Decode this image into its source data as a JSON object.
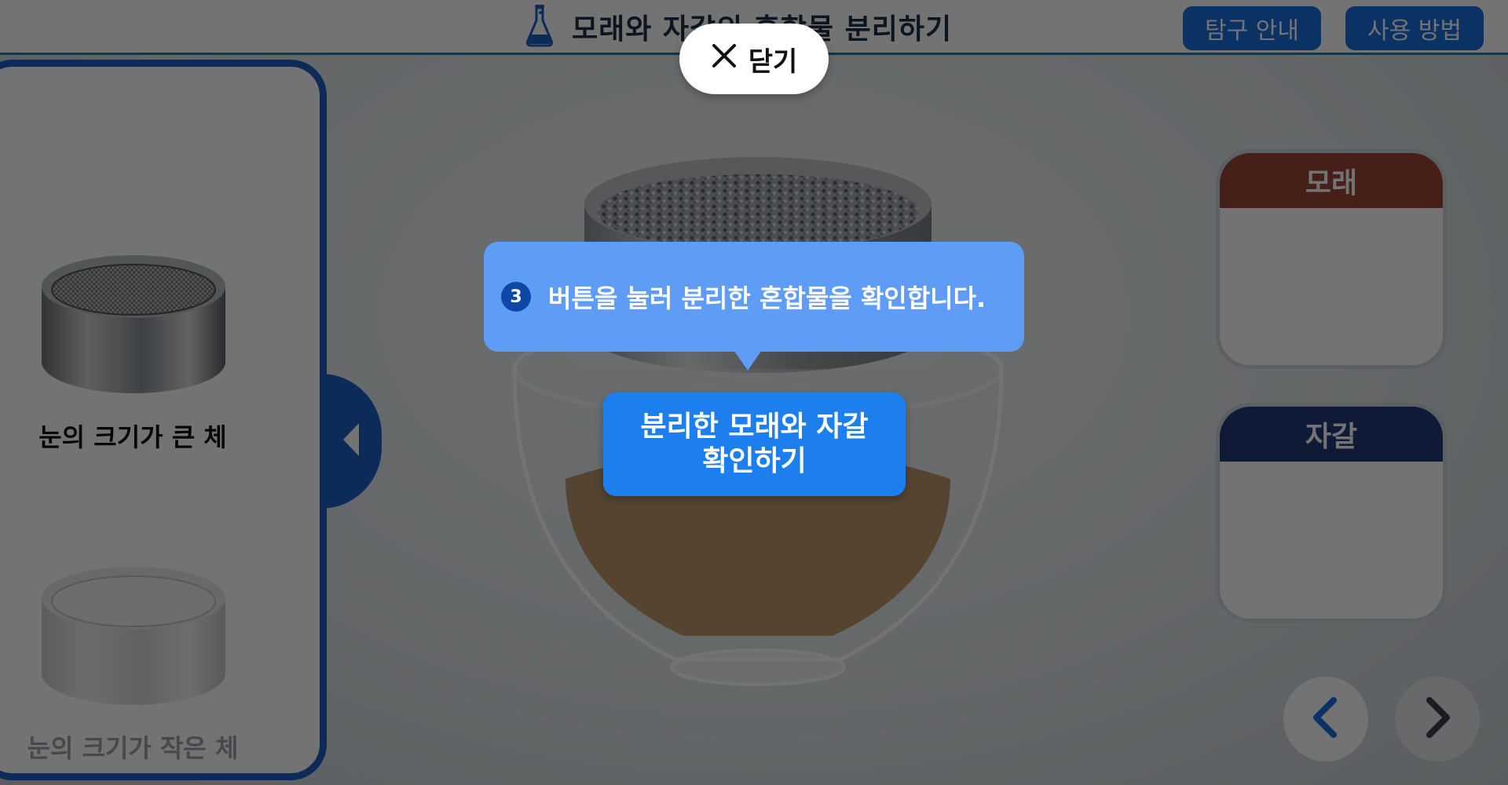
{
  "header": {
    "title": "모래와 자갈의 혼합물 분리하기",
    "guide_button": "탐구 안내",
    "howto_button": "사용 방법",
    "icon": "flask-icon"
  },
  "sidebar": {
    "items": [
      {
        "label": "눈의 크기가 큰 체",
        "icon": "sieve-large-mesh",
        "selected": true
      },
      {
        "label": "눈의 크기가 작은 체",
        "icon": "sieve-small-mesh",
        "selected": false
      }
    ],
    "toggle_icon": "triangle-left-icon"
  },
  "overlay": {
    "close_label": "닫기",
    "close_icon": "close-icon",
    "step_number": "3",
    "instruction": "버튼을 눌러 분리한 혼합물을 확인합니다."
  },
  "main": {
    "confirm_line1": "분리한 모래와 자갈",
    "confirm_line2": "확인하기"
  },
  "results": {
    "sand_label": "모래",
    "gravel_label": "자갈"
  },
  "nav": {
    "prev_icon": "chevron-left-icon",
    "next_icon": "chevron-right-icon"
  },
  "colors": {
    "accent": "#1a6fe0",
    "panel_border": "#1b5fc4",
    "tooltip": "#5f9cf5",
    "sand_header": "#9c4735",
    "gravel_header": "#203a78"
  }
}
